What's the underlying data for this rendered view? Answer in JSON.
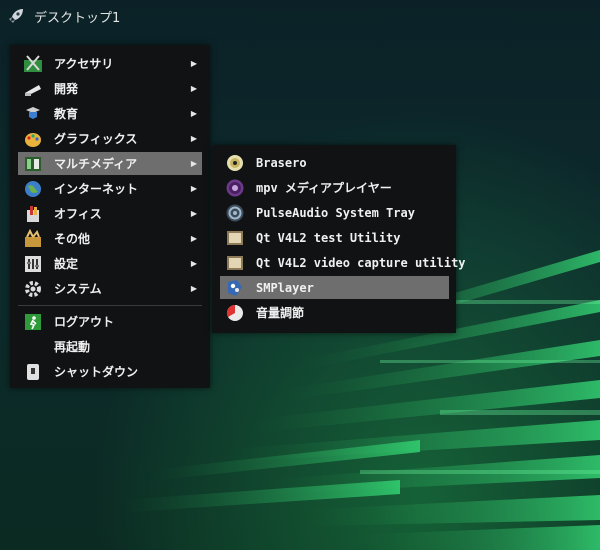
{
  "topbar": {
    "title": "デスクトップ1"
  },
  "main_menu": {
    "items": [
      {
        "label": "アクセサリ",
        "icon": "accessories-icon",
        "has_submenu": true
      },
      {
        "label": "開発",
        "icon": "development-icon",
        "has_submenu": true
      },
      {
        "label": "教育",
        "icon": "education-icon",
        "has_submenu": true
      },
      {
        "label": "グラフィックス",
        "icon": "graphics-icon",
        "has_submenu": true
      },
      {
        "label": "マルチメディア",
        "icon": "multimedia-icon",
        "has_submenu": true,
        "selected": true
      },
      {
        "label": "インターネット",
        "icon": "internet-globe-icon",
        "has_submenu": true
      },
      {
        "label": "オフィス",
        "icon": "office-icon",
        "has_submenu": true
      },
      {
        "label": "その他",
        "icon": "other-icon",
        "has_submenu": true
      },
      {
        "label": "設定",
        "icon": "settings-icon",
        "has_submenu": true
      },
      {
        "label": "システム",
        "icon": "system-gear-icon",
        "has_submenu": true
      }
    ],
    "session_items": [
      {
        "label": "ログアウト",
        "icon": "logout-icon"
      },
      {
        "label": "再起動",
        "icon": ""
      },
      {
        "label": "シャットダウン",
        "icon": "shutdown-icon"
      }
    ],
    "arrow": "▶"
  },
  "sub_menu": {
    "items": [
      {
        "label": "Brasero",
        "icon": "brasero-disc-icon"
      },
      {
        "label": "mpv メディアプレイヤー",
        "icon": "mpv-icon"
      },
      {
        "label": "PulseAudio System Tray",
        "icon": "pulseaudio-icon"
      },
      {
        "label": "Qt V4L2 test Utility",
        "icon": "qv4l2-icon"
      },
      {
        "label": "Qt V4L2 video capture utility",
        "icon": "qvidcap-icon"
      },
      {
        "label": "SMPlayer",
        "icon": "smplayer-icon",
        "highlighted": true
      },
      {
        "label": "音量調節",
        "icon": "volume-control-icon"
      }
    ]
  },
  "colors": {
    "highlight": "#6e6e6e",
    "menu_bg": "#111214",
    "wallpaper_green": "#2fd56a"
  }
}
